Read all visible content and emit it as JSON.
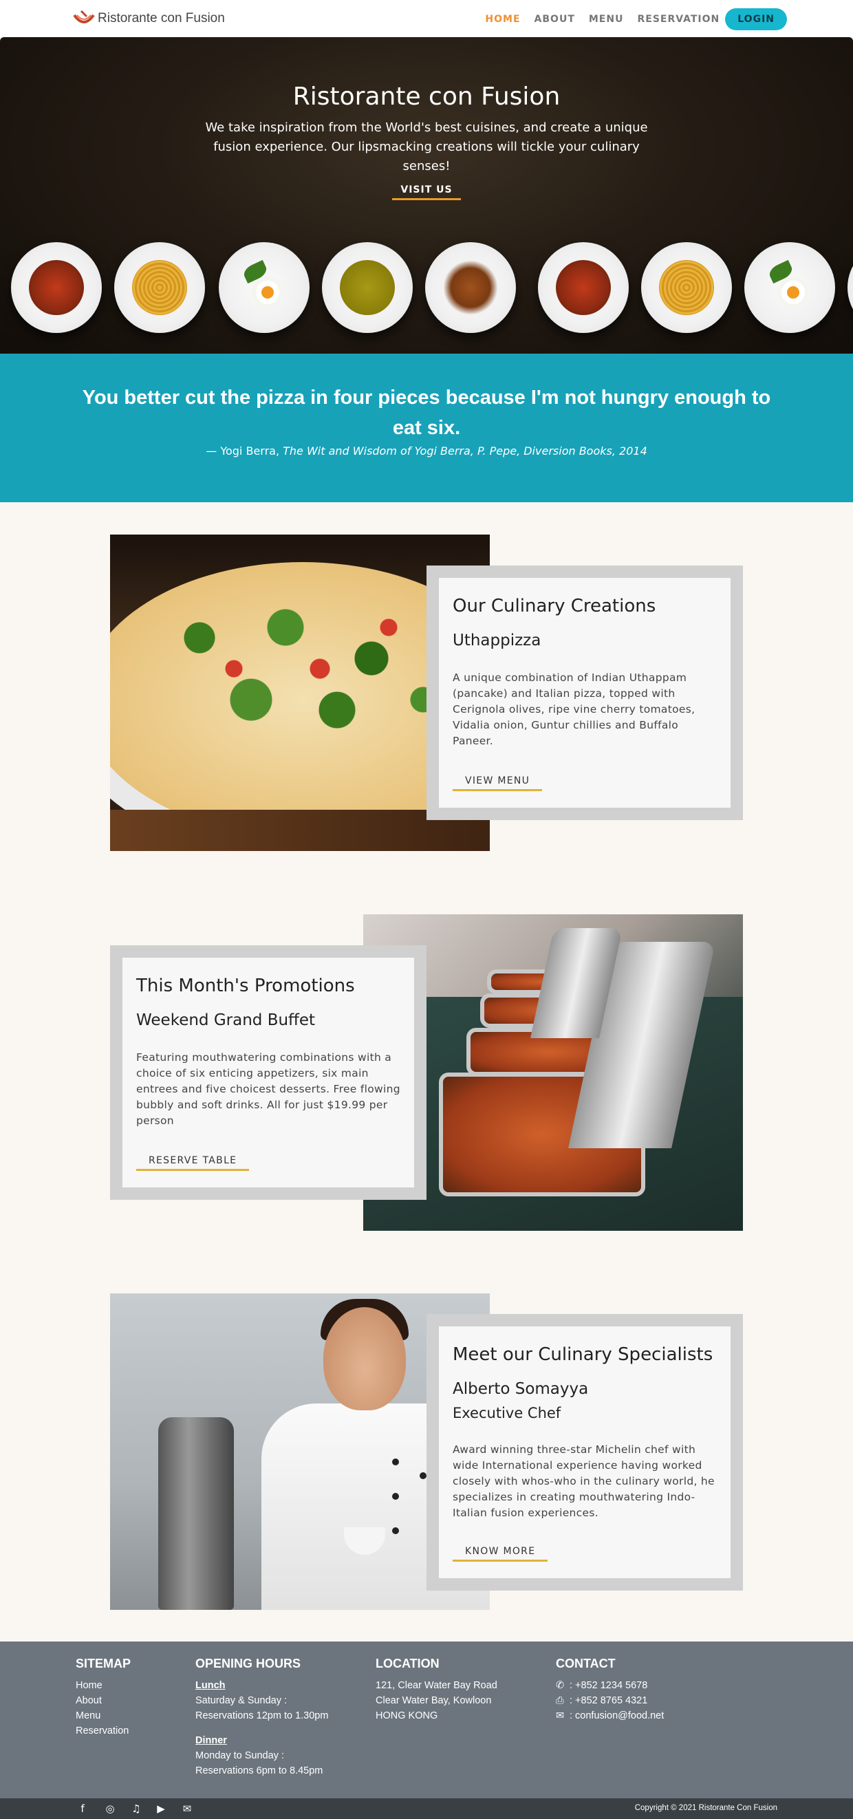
{
  "navbar": {
    "brand": "Ristorante con Fusion",
    "links": [
      "HOME",
      "ABOUT",
      "MENU",
      "RESERVATION"
    ],
    "login": "LOGIN"
  },
  "hero": {
    "title": "Ristorante con Fusion",
    "text": "We take inspiration from the World's best cuisines, and create a unique fusion experience. Our lipsmacking creations will tickle your culinary senses!",
    "button": "VISIT US"
  },
  "quote": {
    "text": "You better cut the pizza in four pieces because I'm not hungry enough to eat six.",
    "author": "— Yogi Berra, ",
    "source": "The Wit and Wisdom of Yogi Berra, P. Pepe, Diversion Books, 2014"
  },
  "dish": {
    "title": "Our Culinary Creations",
    "name": "Uthappizza",
    "description": "A unique combination of Indian Uthappam (pancake) and Italian pizza, topped with Cerignola olives, ripe vine cherry tomatoes, Vidalia onion, Guntur chillies and Buffalo Paneer.",
    "button": "VIEW MENU"
  },
  "promotion": {
    "title": "This Month's Promotions",
    "name": "Weekend Grand Buffet",
    "description": "Featuring mouthwatering combinations with a choice of six enticing appetizers, six main entrees and five choicest desserts. Free flowing bubbly and soft drinks. All for just $19.99 per person",
    "button": "RESERVE TABLE"
  },
  "leader": {
    "title": "Meet our Culinary Specialists",
    "name": "Alberto Somayya",
    "designation": "Executive Chef",
    "description": "Award winning three-star Michelin chef with wide International experience having worked closely with whos-who in the culinary world, he specializes in creating mouthwatering Indo-Italian fusion experiences.",
    "button": "KNOW MORE"
  },
  "footer": {
    "sitemap": {
      "heading": "SITEMAP",
      "links": [
        "Home",
        "About",
        "Menu",
        "Reservation"
      ]
    },
    "hours": {
      "heading": "OPENING HOURS",
      "lunch_label": "Lunch",
      "lunch_days": "Saturday & Sunday :",
      "lunch_time": "Reservations 12pm to 1.30pm",
      "dinner_label": "Dinner",
      "dinner_days": "Monday to Sunday :",
      "dinner_time": "Reservations 6pm to 8.45pm"
    },
    "location": {
      "heading": "LOCATION",
      "lines": [
        "121, Clear Water Bay Road",
        "Clear Water Bay, Kowloon",
        "HONG KONG"
      ]
    },
    "contact": {
      "heading": "CONTACT",
      "phone": ": +852 1234 5678",
      "fax": ": +852 8765 4321",
      "email": ": confusion@food.net"
    },
    "copyright": "Copyright © 2021 Ristorante Con Fusion"
  },
  "colors": {
    "accent": "#ee9035",
    "quote_band": "#18a2b8",
    "login": "#16b6cf",
    "footer": "#6c757d",
    "button_underline": "#e0b336"
  },
  "icons": [
    "brand-logo-icon",
    "facebook-icon",
    "instagram-icon",
    "twitter-icon",
    "youtube-icon",
    "mail-icon",
    "phone-icon",
    "fax-icon",
    "envelope-icon"
  ]
}
